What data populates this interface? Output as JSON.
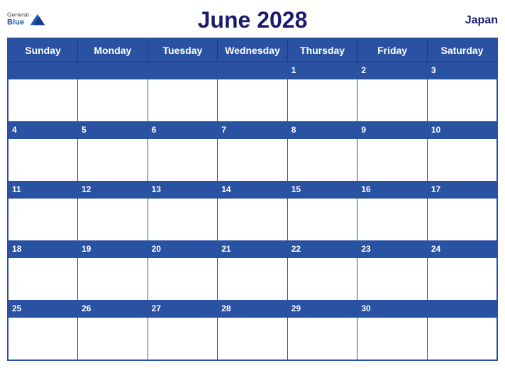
{
  "header": {
    "title": "June 2028",
    "country": "Japan",
    "logo": {
      "general": "General",
      "blue": "Blue"
    }
  },
  "calendar": {
    "days_of_week": [
      "Sunday",
      "Monday",
      "Tuesday",
      "Wednesday",
      "Thursday",
      "Friday",
      "Saturday"
    ],
    "weeks": [
      [
        null,
        null,
        null,
        null,
        1,
        2,
        3
      ],
      [
        4,
        5,
        6,
        7,
        8,
        9,
        10
      ],
      [
        11,
        12,
        13,
        14,
        15,
        16,
        17
      ],
      [
        18,
        19,
        20,
        21,
        22,
        23,
        24
      ],
      [
        25,
        26,
        27,
        28,
        29,
        30,
        null
      ]
    ]
  },
  "colors": {
    "header_bg": "#2952a3",
    "title_color": "#1a1a6e",
    "border": "#2952a3"
  }
}
